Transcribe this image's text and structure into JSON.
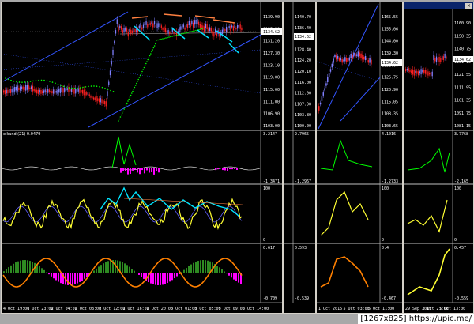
{
  "windows": [
    {
      "id": "main",
      "price_labels": [
        "1139.90",
        "1135.50",
        "1131.20",
        "1127.30",
        "1123.10",
        "1119.00",
        "1115.00",
        "1111.00",
        "1106.90",
        "1103.00"
      ],
      "current_price": "1134.62",
      "indicator_name": "eikandi(21) 0.0479",
      "ind1_scale": [
        "3.2147",
        "-1.3471"
      ],
      "ind2_scale": [
        "100",
        "0"
      ],
      "ind3_scale": [
        "0.617",
        "-0.709"
      ],
      "time_labels": [
        "4 Oct 19:00",
        "1 Oct 23:00",
        "2 Oct 04:00",
        "2 Oct 08:00",
        "2 Oct 12:00",
        "2 Oct 16:00",
        "2 Oct 20:00",
        "5 Oct 01:00",
        "5 Oct 05:00",
        "5 Oct 09:00",
        "5 Oct 14:00"
      ]
    },
    {
      "id": "second",
      "price_labels": [
        "1140.70",
        "1136.40",
        "1132.50",
        "1128.40",
        "1124.20",
        "1120.10",
        "1116.00",
        "1112.00",
        "1107.90",
        "1103.80",
        "1100.00"
      ],
      "current_price": "1134.62",
      "ind1_scale": [
        "2.7965",
        "-1.2967"
      ],
      "ind3_scale": [
        "0.593",
        "-0.539"
      ]
    },
    {
      "id": "third",
      "price_labels": [
        "1165.55",
        "1155.06",
        "1144.00",
        "1139.30",
        "1132.60",
        "1126.75",
        "1120.90",
        "1115.05",
        "1108.35",
        "1103.65"
      ],
      "current_price": "1134.62",
      "ind1_scale": [
        "4.1016",
        "-1.2733"
      ],
      "ind2_scale": [
        "100",
        "0"
      ],
      "ind3_scale": [
        "0.4",
        "-0.467"
      ],
      "time_labels": [
        "1 Oct 2015",
        "5 Oct 03:00",
        "5 Oct 11:00"
      ]
    },
    {
      "id": "fourth",
      "price_labels": [
        "1160.90",
        "1150.35",
        "1140.75",
        "1131.15",
        "1121.55",
        "1111.95",
        "1101.35",
        "1091.75",
        "1081.15"
      ],
      "current_price": "1134.62",
      "ind1_scale": [
        "3.7768",
        "-2.165"
      ],
      "ind2_scale": [
        "100",
        "0"
      ],
      "ind3_scale": [
        "0.457",
        "-0.559"
      ],
      "time_labels": [
        "29 Sep 2015",
        "1 Oct 21:00",
        "5 Oct 13:00"
      ]
    }
  ],
  "colors": {
    "bull_candle": "#8080ff",
    "bear_candle": "#ff2020",
    "channel": "#3355ff",
    "psar": "#00ff00",
    "arrow_up": "#ff8040",
    "arrow_down": "#00e5ff",
    "signal_yellow": "#ffff33",
    "histogram_green": "#2e8b22",
    "histogram_magenta": "#ff00ff",
    "oscillator_orange": "#ff8000"
  },
  "watermark": "[1267x825] https://upic.me/"
}
